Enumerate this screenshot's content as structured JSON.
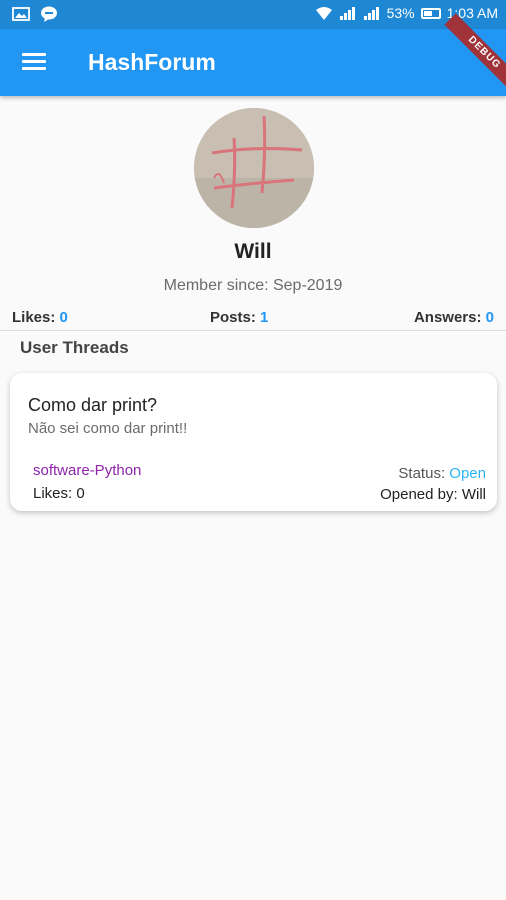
{
  "status_bar": {
    "battery": "53%",
    "time": "1:03 AM",
    "icons": [
      "gallery-icon",
      "chat-icon",
      "wifi-icon",
      "signal-icon",
      "battery-icon"
    ]
  },
  "appbar": {
    "title": "HashForum",
    "debug_label": "DEBUG",
    "color": "#2196f3"
  },
  "profile": {
    "name": "Will",
    "member_since": "Member since: Sep-2019",
    "stats": {
      "likes_label": "Likes:",
      "likes_value": "0",
      "posts_label": "Posts:",
      "posts_value": "1",
      "answers_label": "Answers:",
      "answers_value": "0"
    }
  },
  "threads_section": {
    "title": "User Threads",
    "threads": [
      {
        "title": "Como dar print?",
        "body": "Não sei como dar print!!",
        "tag": "software-Python",
        "likes": "Likes: 0",
        "status_label": "Status:",
        "status_value": "Open",
        "opened_by": "Opened by: Will"
      }
    ]
  }
}
